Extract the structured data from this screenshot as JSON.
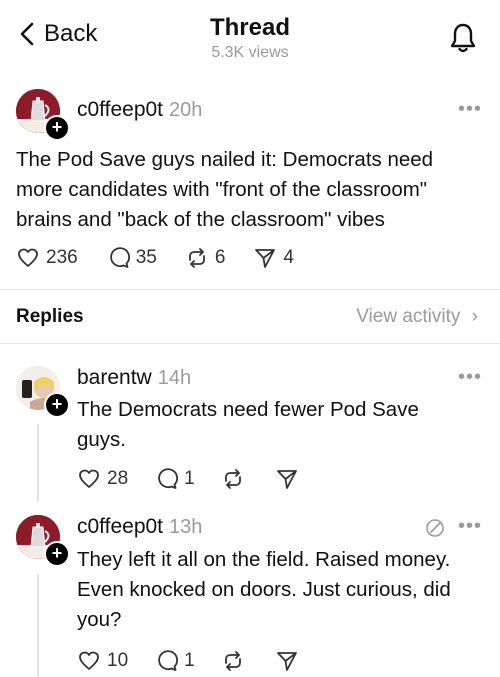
{
  "header": {
    "back_label": "Back",
    "title": "Thread",
    "views": "5.3K views",
    "bell_icon": "bell-icon"
  },
  "main_post": {
    "username": "c0ffeep0t",
    "time": "20h",
    "text_lines": [
      "The Pod Save guys nailed it: Democrats need",
      "more candidates with \"front of the classroom\"",
      "brains and \"back of the classroom\" vibes"
    ],
    "likes": "236",
    "comments": "35",
    "reposts": "6",
    "shares": "4"
  },
  "replies_header": {
    "label": "Replies",
    "view_activity": "View activity"
  },
  "replies": [
    {
      "username": "barentw",
      "time": "14h",
      "text_lines": [
        "The Democrats need fewer Pod Save",
        "guys."
      ],
      "likes": "28",
      "comments": "1"
    },
    {
      "username": "c0ffeep0t",
      "time": "13h",
      "text_lines": [
        "They left it all on the field. Raised money.",
        "Even knocked on doors. Just curious, did",
        "you?"
      ],
      "likes": "10",
      "comments": "1"
    }
  ],
  "colors": {
    "text": "#111111",
    "muted": "#9a9a9a",
    "divider": "#e5e5e5",
    "avatar_bg": "#8e1c28"
  }
}
